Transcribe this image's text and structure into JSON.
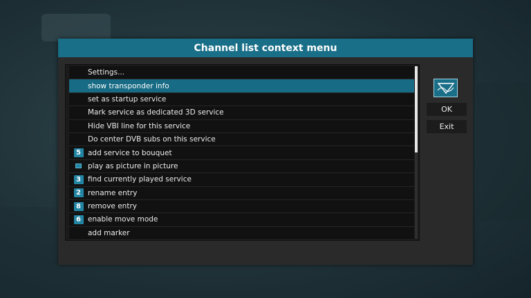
{
  "dialog": {
    "title": "Channel list context menu",
    "ok_label": "OK",
    "exit_label": "Exit",
    "logo_icon": "picture-frame-logo-icon"
  },
  "menu": {
    "items": [
      {
        "label": "Settings...",
        "key": "",
        "selected": false
      },
      {
        "label": "show transponder info",
        "key": "",
        "selected": true
      },
      {
        "label": "set as startup service",
        "key": "",
        "selected": false
      },
      {
        "label": "Mark service as dedicated 3D service",
        "key": "",
        "selected": false
      },
      {
        "label": "Hide VBI line for this service",
        "key": "",
        "selected": false
      },
      {
        "label": "Do center DVB subs on this service",
        "key": "",
        "selected": false
      },
      {
        "label": "add service to bouquet",
        "key": "5",
        "selected": false
      },
      {
        "label": "play as picture in picture",
        "key": "",
        "icon": "pip-icon",
        "selected": false
      },
      {
        "label": "find currently played service",
        "key": "3",
        "selected": false
      },
      {
        "label": "rename entry",
        "key": "2",
        "selected": false
      },
      {
        "label": "remove entry",
        "key": "8",
        "selected": false
      },
      {
        "label": "enable move mode",
        "key": "6",
        "selected": false
      },
      {
        "label": "add marker",
        "key": "",
        "selected": false
      }
    ]
  },
  "colors": {
    "accent": "#1a6f88",
    "selected_row": "#176b85",
    "key_badge": "#2385a4"
  }
}
